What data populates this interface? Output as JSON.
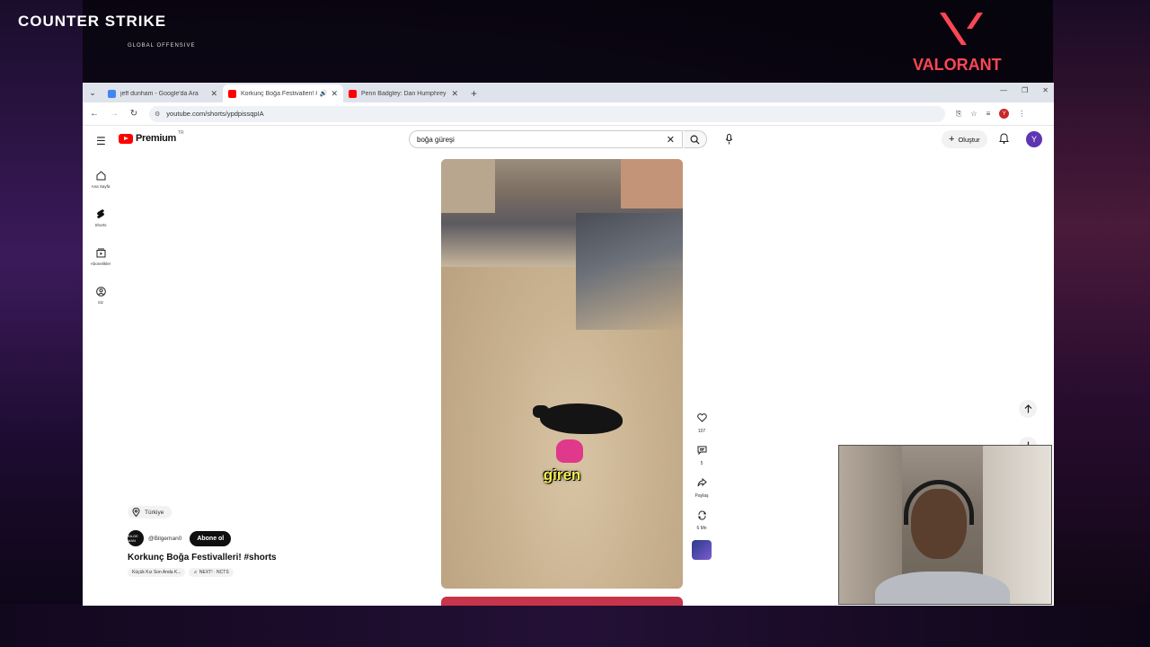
{
  "overlay": {
    "left_logo": "COUNTER STRIKE",
    "left_logo_sub": "GLOBAL OFFENSIVE",
    "right_logo": "VALORANT"
  },
  "browser": {
    "tabs": [
      {
        "title": "jeff dunham - Google'da Ara",
        "favicon_color": "#4285f4",
        "active": false
      },
      {
        "title": "Korkunç Boğa Festivalleri! #",
        "favicon_color": "#ff0000",
        "active": true,
        "audio": true
      },
      {
        "title": "Penn Badgley: Dan Humphrey",
        "favicon_color": "#ff0000",
        "active": false
      }
    ],
    "url": "youtube.com/shorts/ypdpissqpIA"
  },
  "youtube": {
    "logo_text": "Premium",
    "region": "TR",
    "search_value": "boğa güreşi",
    "create_label": "Oluştur",
    "avatar_letter": "Y",
    "guide": [
      {
        "label": "Ana Sayfa",
        "icon": "home-icon"
      },
      {
        "label": "Shorts",
        "icon": "shorts-icon"
      },
      {
        "label": "Abonelikler",
        "icon": "subscriptions-icon"
      },
      {
        "label": "Siz",
        "icon": "you-icon"
      }
    ],
    "short": {
      "caption": "giren",
      "location": "Türkiye",
      "channel": "@Bilgeman0",
      "channel_avatar_text": "BİLGE MAN",
      "subscribe_label": "Abone ol",
      "title": "Korkunç Boğa Festivalleri! #shorts",
      "music": [
        "Küçük Kız Son Anda K...",
        "♬ NEXT! · NCTS"
      ]
    },
    "actions": {
      "likes": "107",
      "comments": "5",
      "share": "Paylaş",
      "remix": "6 Mn"
    }
  }
}
